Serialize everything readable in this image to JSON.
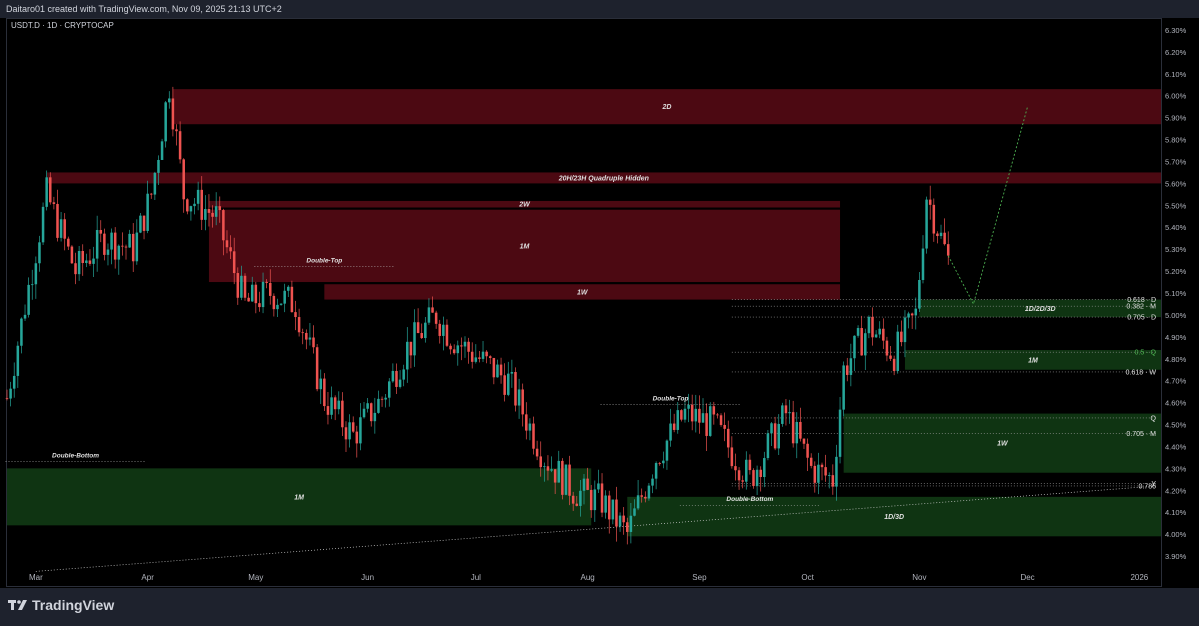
{
  "header": {
    "attribution": "Daitaro01 created with TradingView.com, Nov 09, 2025 21:13 UTC+2"
  },
  "symbol": {
    "label": "USDT.D · 1D · CRYPTOCAP"
  },
  "footer": {
    "brand": "TradingView"
  },
  "colors": {
    "up": "#26a69a",
    "down": "#ef5350",
    "supply": "#8b1020",
    "demand": "#1b5e20",
    "bg": "#000000",
    "panel": "#1e222d",
    "axis_text": "#b2b5be"
  },
  "chart_data": {
    "type": "candlestick",
    "y_axis": {
      "min": 3.85,
      "max": 6.35,
      "position": "right",
      "ticks": [
        "6.30%",
        "6.20%",
        "6.10%",
        "6.00%",
        "5.90%",
        "5.80%",
        "5.70%",
        "5.60%",
        "5.50%",
        "5.40%",
        "5.30%",
        "5.20%",
        "5.10%",
        "5.00%",
        "4.90%",
        "4.80%",
        "4.70%",
        "4.60%",
        "4.50%",
        "4.40%",
        "4.30%",
        "4.20%",
        "4.10%",
        "4.00%",
        "3.90%"
      ],
      "tick_values": [
        6.3,
        6.2,
        6.1,
        6.0,
        5.9,
        5.8,
        5.7,
        5.6,
        5.5,
        5.4,
        5.3,
        5.2,
        5.1,
        5.0,
        4.9,
        4.8,
        4.7,
        4.6,
        4.5,
        4.4,
        4.3,
        4.2,
        4.1,
        4.0,
        3.9
      ]
    },
    "x_axis": {
      "labels": [
        {
          "label": "Mar",
          "date": "2025-03-01"
        },
        {
          "label": "Apr",
          "date": "2025-04-01"
        },
        {
          "label": "May",
          "date": "2025-05-01"
        },
        {
          "label": "Jun",
          "date": "2025-06-01"
        },
        {
          "label": "Jul",
          "date": "2025-07-01"
        },
        {
          "label": "Aug",
          "date": "2025-08-01"
        },
        {
          "label": "Sep",
          "date": "2025-09-01"
        },
        {
          "label": "Oct",
          "date": "2025-10-01"
        },
        {
          "label": "Nov",
          "date": "2025-11-01"
        },
        {
          "label": "Dec",
          "date": "2025-12-01"
        },
        {
          "label": "2026",
          "date": "2026-01-01"
        }
      ],
      "range": [
        "2025-02-21",
        "2026-01-07"
      ]
    },
    "price_path": [
      [
        "2025-02-21",
        4.62
      ],
      [
        "2025-03-04",
        5.55
      ],
      [
        "2025-03-12",
        5.2
      ],
      [
        "2025-03-20",
        5.35
      ],
      [
        "2025-03-28",
        5.3
      ],
      [
        "2025-04-02",
        5.55
      ],
      [
        "2025-04-07",
        6.05
      ],
      [
        "2025-04-11",
        5.55
      ],
      [
        "2025-04-20",
        5.45
      ],
      [
        "2025-04-28",
        5.05
      ],
      [
        "2025-05-05",
        5.1
      ],
      [
        "2025-05-12",
        5.05
      ],
      [
        "2025-05-20",
        4.62
      ],
      [
        "2025-05-28",
        4.45
      ],
      [
        "2025-06-05",
        4.62
      ],
      [
        "2025-06-12",
        4.85
      ],
      [
        "2025-06-20",
        5.0
      ],
      [
        "2025-06-24",
        4.9
      ],
      [
        "2025-07-02",
        4.8
      ],
      [
        "2025-07-10",
        4.7
      ],
      [
        "2025-07-20",
        4.35
      ],
      [
        "2025-07-28",
        4.2
      ],
      [
        "2025-08-05",
        4.15
      ],
      [
        "2025-08-12",
        4.0
      ],
      [
        "2025-08-20",
        4.35
      ],
      [
        "2025-08-28",
        4.55
      ],
      [
        "2025-09-05",
        4.5
      ],
      [
        "2025-09-15",
        4.25
      ],
      [
        "2025-09-25",
        4.55
      ],
      [
        "2025-10-02",
        4.3
      ],
      [
        "2025-10-08",
        4.25
      ],
      [
        "2025-10-11",
        4.75
      ],
      [
        "2025-10-18",
        4.95
      ],
      [
        "2025-10-25",
        4.82
      ],
      [
        "2025-10-31",
        5.0
      ],
      [
        "2025-11-03",
        5.55
      ],
      [
        "2025-11-06",
        5.4
      ],
      [
        "2025-11-09",
        5.25
      ]
    ],
    "zones": [
      {
        "label": "2D",
        "type": "supply",
        "from": "2025-04-08",
        "to": "2026-01-07",
        "y1": 5.87,
        "y2": 6.03
      },
      {
        "label": "20H/23H Quadruple Hidden",
        "type": "supply",
        "from": "2025-03-04",
        "to": "2026-01-07",
        "y1": 5.6,
        "y2": 5.65
      },
      {
        "label": "2W",
        "type": "supply",
        "from": "2025-04-18",
        "to": "2025-10-10",
        "y1": 5.49,
        "y2": 5.52
      },
      {
        "label": "1M",
        "type": "supply",
        "from": "2025-04-18",
        "to": "2025-10-10",
        "y1": 5.15,
        "y2": 5.48
      },
      {
        "label": "1W",
        "type": "supply",
        "from": "2025-05-20",
        "to": "2025-10-10",
        "y1": 5.07,
        "y2": 5.14
      },
      {
        "label": "1D/2D/3D",
        "type": "demand",
        "from": "2025-11-01",
        "to": "2026-01-07",
        "y1": 4.99,
        "y2": 5.07
      },
      {
        "label": "1M",
        "type": "demand",
        "from": "2025-10-28",
        "to": "2026-01-07",
        "y1": 4.75,
        "y2": 4.84
      },
      {
        "label": "1W",
        "type": "demand",
        "from": "2025-10-11",
        "to": "2026-01-07",
        "y1": 4.28,
        "y2": 4.55
      },
      {
        "label": "1M",
        "type": "demand",
        "from": "2025-02-21",
        "to": "2025-08-02",
        "y1": 4.04,
        "y2": 4.3
      },
      {
        "label": "1D/3D",
        "type": "demand",
        "from": "2025-08-12",
        "to": "2026-01-07",
        "y1": 3.99,
        "y2": 4.17
      }
    ],
    "fib_levels": [
      {
        "label": "0.618 · D",
        "value": 5.07
      },
      {
        "label": "0.382 · M",
        "value": 5.04
      },
      {
        "label": "0.705 · D",
        "value": 4.99
      },
      {
        "label": "0.5 · Q",
        "value": 4.83,
        "color": "#4caf50"
      },
      {
        "label": "0.618 · W",
        "value": 4.74
      },
      {
        "label": "Q",
        "value": 4.53
      },
      {
        "label": "0.705 · M",
        "value": 4.46
      },
      {
        "label": "Y",
        "value": 4.23
      },
      {
        "label": "0.786",
        "value": 4.22
      }
    ],
    "annotations": [
      {
        "label": "Double-Top",
        "date": "2025-05-20",
        "value": 5.24
      },
      {
        "label": "Double-Top",
        "date": "2025-08-24",
        "value": 4.61
      },
      {
        "label": "Double-Bottom",
        "date": "2025-03-12",
        "value": 4.35
      },
      {
        "label": "Double-Bottom",
        "date": "2025-09-15",
        "value": 4.15
      }
    ],
    "projection": [
      [
        "2025-11-09",
        5.27
      ],
      [
        "2025-11-16",
        5.05
      ],
      [
        "2025-12-01",
        5.95
      ]
    ]
  }
}
